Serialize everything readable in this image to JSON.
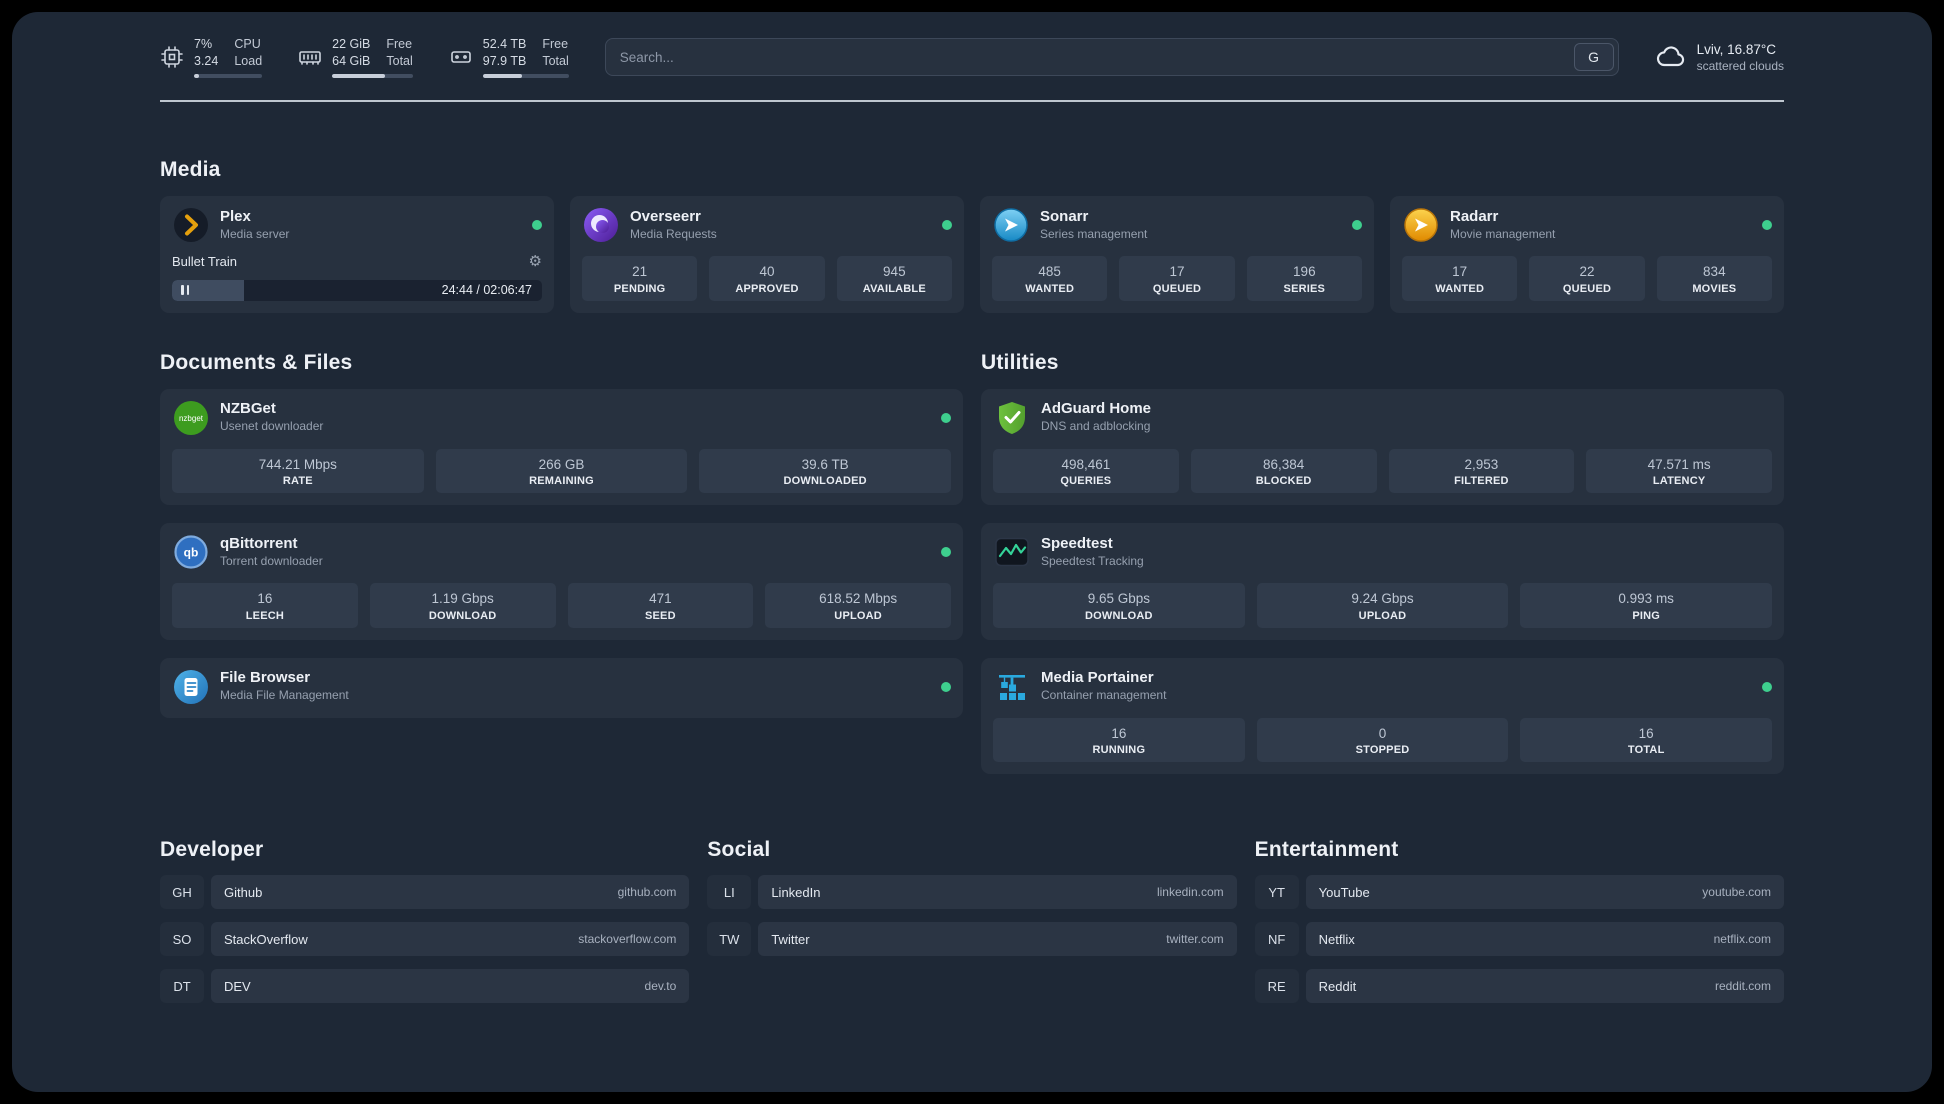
{
  "theme": {
    "status_green": "#3ecf8e",
    "background": "#1e2836",
    "card": "#27313f",
    "plex_accent": "#e5a00d"
  },
  "topbar": {
    "resources": [
      {
        "icon": "cpu-icon",
        "values": [
          "7%",
          "3.24"
        ],
        "labels": [
          "CPU",
          "Load"
        ],
        "percent": 7
      },
      {
        "icon": "memory-icon",
        "values": [
          "22 GiB",
          "64 GiB"
        ],
        "labels": [
          "Free",
          "Total"
        ],
        "percent": 66
      },
      {
        "icon": "disk-icon",
        "values": [
          "52.4 TB",
          "97.9 TB"
        ],
        "labels": [
          "Free",
          "Total"
        ],
        "percent": 46
      }
    ],
    "search": {
      "placeholder": "Search...",
      "button": "G"
    },
    "weather": {
      "location": "Lviv, 16.87°C",
      "condition": "scattered clouds"
    }
  },
  "groups": {
    "media": {
      "title": "Media"
    },
    "documents": {
      "title": "Documents & Files"
    },
    "utilities": {
      "title": "Utilities"
    },
    "developer": {
      "title": "Developer"
    },
    "social": {
      "title": "Social"
    },
    "entertainment": {
      "title": "Entertainment"
    }
  },
  "services": {
    "plex": {
      "name": "Plex",
      "desc": "Media server",
      "now_playing": "Bullet Train",
      "time": "24:44 / 02:06:47",
      "progress_percent": 19.5
    },
    "overseerr": {
      "name": "Overseerr",
      "desc": "Media Requests",
      "stats": [
        {
          "value": "21",
          "label": "PENDING"
        },
        {
          "value": "40",
          "label": "APPROVED"
        },
        {
          "value": "945",
          "label": "AVAILABLE"
        }
      ]
    },
    "sonarr": {
      "name": "Sonarr",
      "desc": "Series management",
      "stats": [
        {
          "value": "485",
          "label": "WANTED"
        },
        {
          "value": "17",
          "label": "QUEUED"
        },
        {
          "value": "196",
          "label": "SERIES"
        }
      ]
    },
    "radarr": {
      "name": "Radarr",
      "desc": "Movie management",
      "stats": [
        {
          "value": "17",
          "label": "WANTED"
        },
        {
          "value": "22",
          "label": "QUEUED"
        },
        {
          "value": "834",
          "label": "MOVIES"
        }
      ]
    },
    "nzbget": {
      "name": "NZBGet",
      "desc": "Usenet downloader",
      "stats": [
        {
          "value": "744.21 Mbps",
          "label": "RATE"
        },
        {
          "value": "266 GB",
          "label": "REMAINING"
        },
        {
          "value": "39.6 TB",
          "label": "DOWNLOADED"
        }
      ]
    },
    "qbittorrent": {
      "name": "qBittorrent",
      "desc": "Torrent downloader",
      "stats": [
        {
          "value": "16",
          "label": "LEECH"
        },
        {
          "value": "1.19 Gbps",
          "label": "DOWNLOAD"
        },
        {
          "value": "471",
          "label": "SEED"
        },
        {
          "value": "618.52 Mbps",
          "label": "UPLOAD"
        }
      ]
    },
    "filebrowser": {
      "name": "File Browser",
      "desc": "Media File Management"
    },
    "adguard": {
      "name": "AdGuard Home",
      "desc": "DNS and adblocking",
      "stats": [
        {
          "value": "498,461",
          "label": "QUERIES"
        },
        {
          "value": "86,384",
          "label": "BLOCKED"
        },
        {
          "value": "2,953",
          "label": "FILTERED"
        },
        {
          "value": "47.571 ms",
          "label": "LATENCY"
        }
      ]
    },
    "speedtest": {
      "name": "Speedtest",
      "desc": "Speedtest Tracking",
      "stats": [
        {
          "value": "9.65 Gbps",
          "label": "DOWNLOAD"
        },
        {
          "value": "9.24 Gbps",
          "label": "UPLOAD"
        },
        {
          "value": "0.993 ms",
          "label": "PING"
        }
      ]
    },
    "portainer": {
      "name": "Media Portainer",
      "desc": "Container management",
      "stats": [
        {
          "value": "16",
          "label": "RUNNING"
        },
        {
          "value": "0",
          "label": "STOPPED"
        },
        {
          "value": "16",
          "label": "TOTAL"
        }
      ]
    }
  },
  "bookmarks": {
    "developer": [
      {
        "abbr": "GH",
        "name": "Github",
        "url": "github.com"
      },
      {
        "abbr": "SO",
        "name": "StackOverflow",
        "url": "stackoverflow.com"
      },
      {
        "abbr": "DT",
        "name": "DEV",
        "url": "dev.to"
      }
    ],
    "social": [
      {
        "abbr": "LI",
        "name": "LinkedIn",
        "url": "linkedin.com"
      },
      {
        "abbr": "TW",
        "name": "Twitter",
        "url": "twitter.com"
      }
    ],
    "entertainment": [
      {
        "abbr": "YT",
        "name": "YouTube",
        "url": "youtube.com"
      },
      {
        "abbr": "NF",
        "name": "Netflix",
        "url": "netflix.com"
      },
      {
        "abbr": "RE",
        "name": "Reddit",
        "url": "reddit.com"
      }
    ]
  }
}
